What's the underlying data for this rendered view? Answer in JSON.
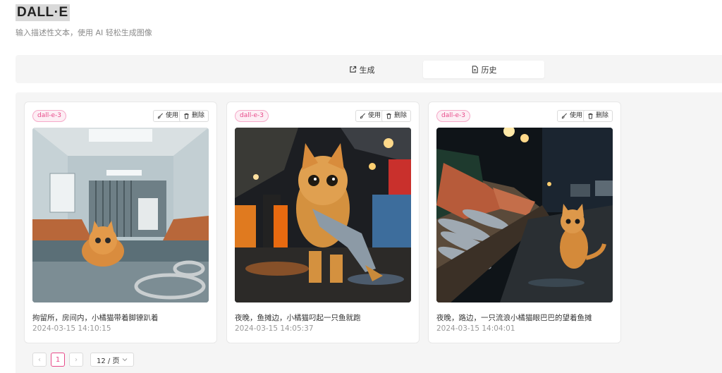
{
  "header": {
    "title": "DALL·E",
    "subtitle": "输入描述性文本，使用 AI 轻松生成图像"
  },
  "tabs": [
    {
      "label": "生成",
      "icon": "external-edit-icon",
      "active": false
    },
    {
      "label": "历史",
      "icon": "document-icon",
      "active": true
    }
  ],
  "actions": {
    "use": "使用",
    "delete": "删除"
  },
  "cards": [
    {
      "model": "dall-e-3",
      "prompt": "拘留所，房间内，小橘猫带着脚镣趴着",
      "date": "2024-03-15 14:10:15"
    },
    {
      "model": "dall-e-3",
      "prompt": "夜晚，鱼摊边，小橘猫叼起一只鱼就跑",
      "date": "2024-03-15 14:05:37"
    },
    {
      "model": "dall-e-3",
      "prompt": "夜晚，路边，一只流浪小橘猫眼巴巴的望着鱼摊",
      "date": "2024-03-15 14:04:01"
    }
  ],
  "pagination": {
    "prev": "‹",
    "current": "1",
    "next": "›",
    "page_size": "12 / 页"
  },
  "colors": {
    "accent": "#e84a8a",
    "background": "#f5f5f5"
  }
}
